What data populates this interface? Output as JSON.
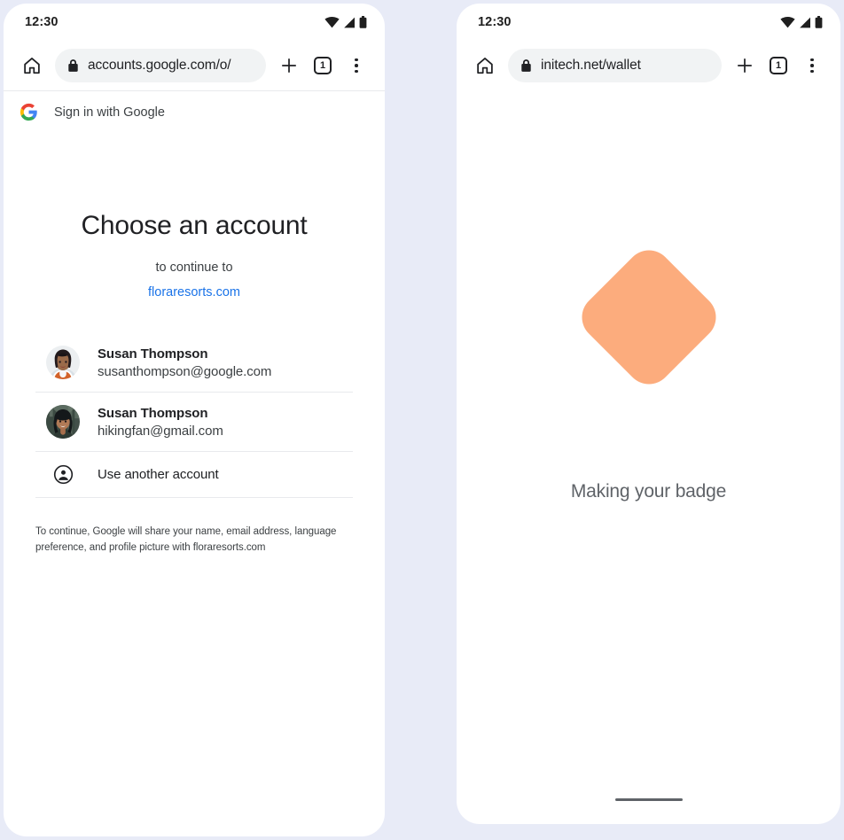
{
  "background_color": "#e8ebf7",
  "left_phone": {
    "status_bar": {
      "time": "12:30",
      "icons": [
        "wifi-icon",
        "cell-signal-icon",
        "battery-icon"
      ]
    },
    "toolbar": {
      "home_icon": "home-icon",
      "lock_icon": "lock-icon",
      "url": "accounts.google.com/o/",
      "new_tab_icon": "plus-icon",
      "tab_count": "1",
      "menu_icon": "overflow-menu-icon"
    },
    "page_header": {
      "logo": "google-g-logo",
      "label": "Sign in with Google"
    },
    "content": {
      "title": "Choose an account",
      "subtitle": "to continue to",
      "domain": "floraresorts.com",
      "domain_color": "#1a73e8",
      "accounts": [
        {
          "name": "Susan Thompson",
          "email": "susanthompson@google.com",
          "avatar": "avatar-photo-susan-google"
        },
        {
          "name": "Susan Thompson",
          "email": "hikingfan@gmail.com",
          "avatar": "avatar-photo-susan-gmail"
        }
      ],
      "use_another_account": {
        "label": "Use another account",
        "icon": "account-circle-icon"
      },
      "disclaimer": "To continue, Google will share your name, email address, language preference, and profile picture with floraresorts.com"
    }
  },
  "right_phone": {
    "status_bar": {
      "time": "12:30",
      "icons": [
        "wifi-icon",
        "cell-signal-icon",
        "battery-icon"
      ]
    },
    "toolbar": {
      "home_icon": "home-icon",
      "lock_icon": "lock-icon",
      "url": "initech.net/wallet",
      "new_tab_icon": "plus-icon",
      "tab_count": "1",
      "menu_icon": "overflow-menu-icon"
    },
    "content": {
      "badge_shape_color": "#fcac7d",
      "caption": "Making your badge"
    }
  }
}
